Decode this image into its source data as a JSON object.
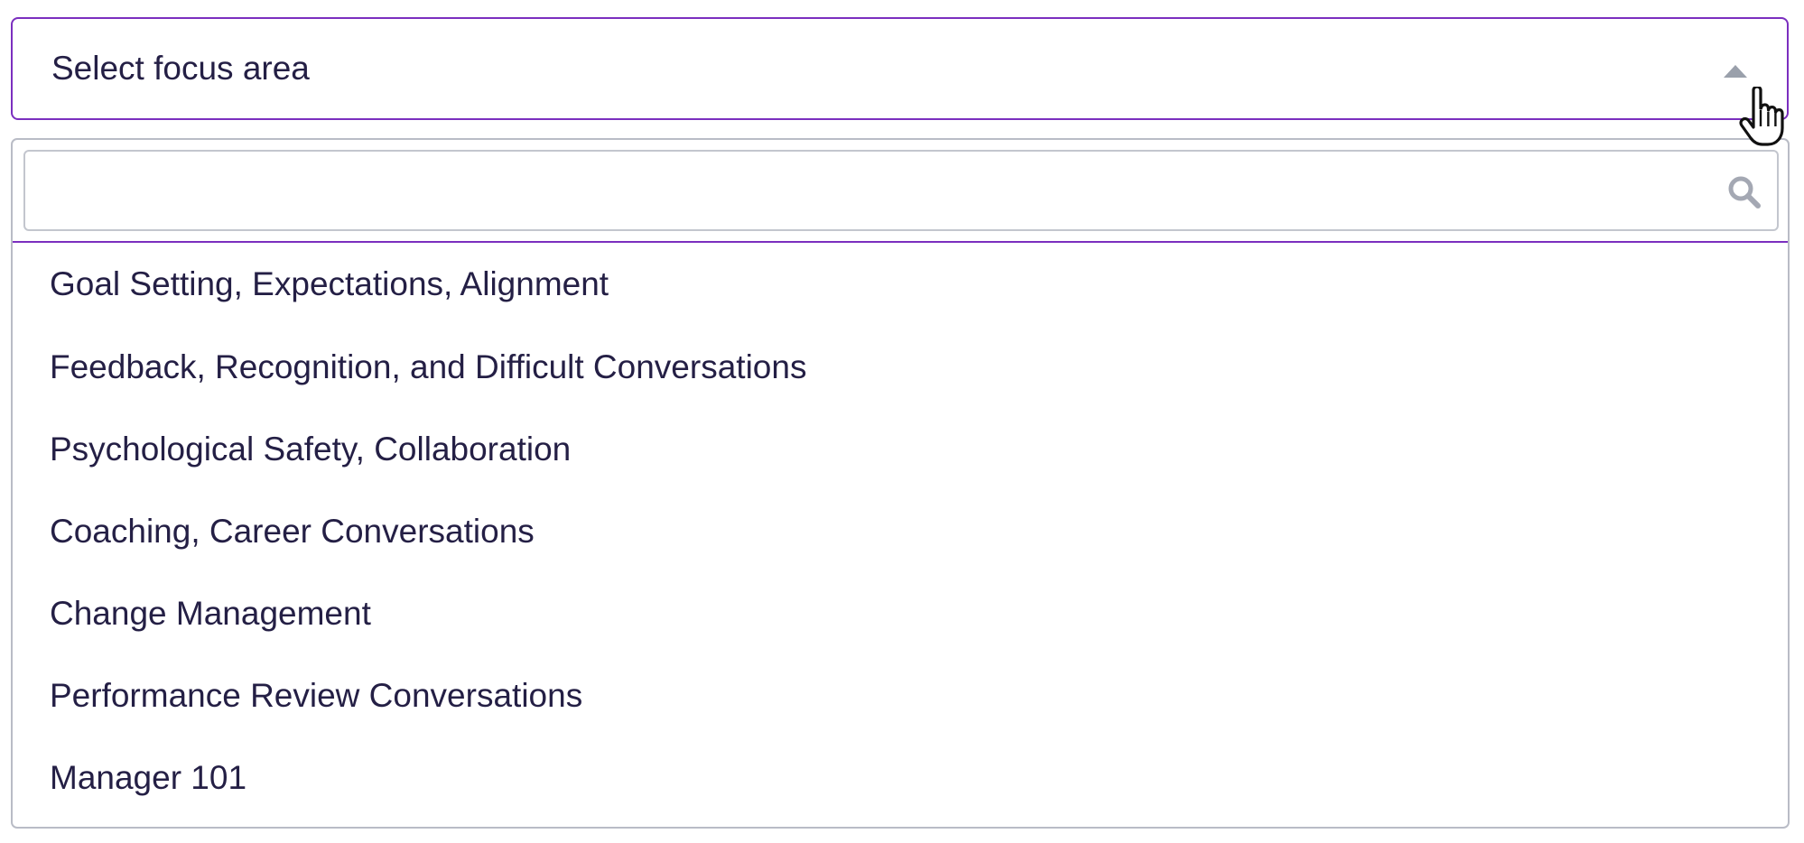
{
  "select": {
    "value": "Select focus area",
    "caret_icon": "caret-up-icon",
    "state": "open"
  },
  "search": {
    "value": "",
    "placeholder": "",
    "icon": "search-icon"
  },
  "options": [
    {
      "label": "Goal Setting, Expectations, Alignment"
    },
    {
      "label": "Feedback, Recognition, and Difficult Conversations"
    },
    {
      "label": "Psychological Safety, Collaboration"
    },
    {
      "label": "Coaching, Career Conversations"
    },
    {
      "label": "Change Management"
    },
    {
      "label": "Performance Review Conversations"
    },
    {
      "label": "Manager 101"
    }
  ],
  "colors": {
    "focus_border": "#7b2fbf",
    "text": "#241f45",
    "muted": "#9aa0ab",
    "border": "#b9bcc6"
  },
  "cursor": "hand-pointer-icon"
}
